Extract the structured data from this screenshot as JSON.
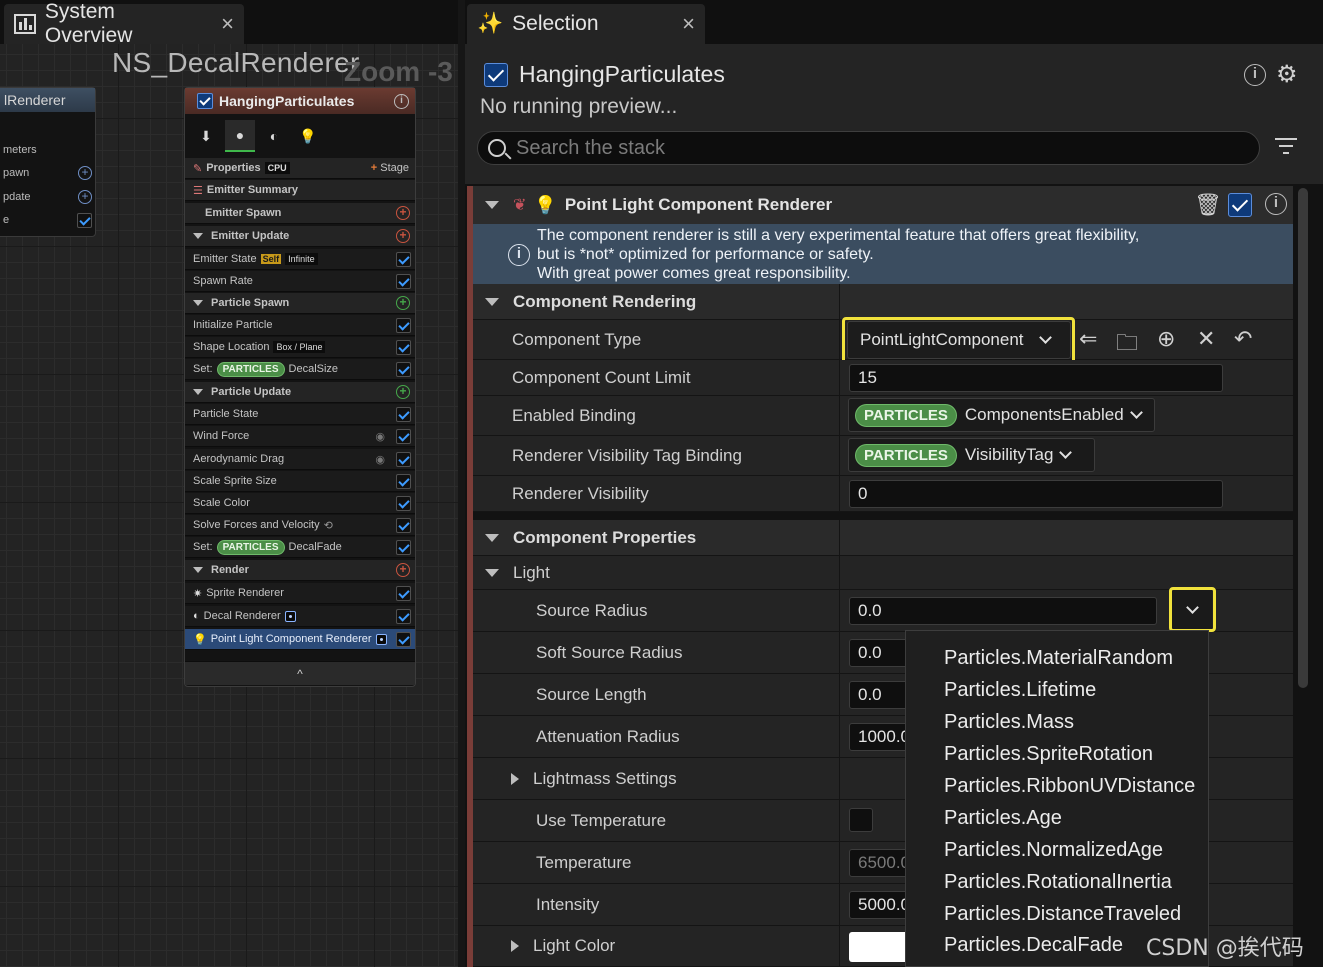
{
  "left_tab": {
    "title": "System Overview",
    "close": "×"
  },
  "graph": {
    "title": "NS_DecalRenderer",
    "zoom": "Zoom -3"
  },
  "node_left": {
    "title": "lRenderer",
    "rows": [
      "meters",
      "pawn",
      "pdate",
      "e"
    ]
  },
  "node_main": {
    "title": "HangingParticulates",
    "properties_label": "Properties",
    "cpu_badge": "CPU",
    "stage_label": "Stage",
    "rows": [
      {
        "label": "Emitter Summary"
      },
      {
        "label": "Emitter Spawn"
      },
      {
        "label": "Emitter Update"
      },
      {
        "label": "Emitter State",
        "badge1": "Self",
        "badge2": "Infinite"
      },
      {
        "label": "Spawn Rate"
      },
      {
        "label": "Particle Spawn"
      },
      {
        "label": "Initialize Particle"
      },
      {
        "label": "Shape Location",
        "badge2": "Box / Plane"
      },
      {
        "label": "Set:",
        "pill": "PARTICLES",
        "suffix": "DecalSize"
      },
      {
        "label": "Particle Update"
      },
      {
        "label": "Particle State"
      },
      {
        "label": "Wind Force"
      },
      {
        "label": "Aerodynamic Drag"
      },
      {
        "label": "Scale Sprite Size"
      },
      {
        "label": "Scale Color"
      },
      {
        "label": "Solve Forces and Velocity"
      },
      {
        "label": "Set:",
        "pill": "PARTICLES",
        "suffix": "DecalFade"
      },
      {
        "label": "Render"
      },
      {
        "label": "Sprite Renderer"
      },
      {
        "label": "Decal Renderer"
      },
      {
        "label": "Point Light Component Renderer"
      }
    ],
    "collapse": "^"
  },
  "right_tab": {
    "title": "Selection",
    "close": "×"
  },
  "selection": {
    "name": "HangingParticulates",
    "status": "No running preview...",
    "search_placeholder": "Search the stack"
  },
  "renderer": {
    "title": "Point Light Component Renderer",
    "warning": [
      "The component renderer is still a very experimental feature that offers great flexibility,",
      "but is *not* optimized for performance or safety.",
      "With great power comes great responsibility."
    ]
  },
  "properties": {
    "component_rendering": "Component Rendering",
    "component_type_label": "Component Type",
    "component_type_value": "PointLightComponent",
    "count_limit_label": "Component Count Limit",
    "count_limit_value": "15",
    "enabled_binding_label": "Enabled Binding",
    "enabled_binding_pill": "PARTICLES",
    "enabled_binding_value": "ComponentsEnabled",
    "vis_tag_label": "Renderer Visibility Tag Binding",
    "vis_tag_pill": "PARTICLES",
    "vis_tag_value": "VisibilityTag",
    "renderer_vis_label": "Renderer Visibility",
    "renderer_vis_value": "0",
    "component_properties": "Component Properties",
    "light": "Light",
    "source_radius_label": "Source Radius",
    "source_radius_value": "0.0",
    "soft_source_radius_label": "Soft Source Radius",
    "soft_source_radius_value": "0.0",
    "source_length_label": "Source Length",
    "source_length_value": "0.0",
    "attenuation_label": "Attenuation Radius",
    "attenuation_value": "1000.0",
    "lightmass_label": "Lightmass Settings",
    "use_temp_label": "Use Temperature",
    "temperature_label": "Temperature",
    "temperature_value": "6500.0",
    "intensity_label": "Intensity",
    "intensity_value": "5000.0",
    "light_color_label": "Light Color"
  },
  "dropdown": [
    "Particles.MaterialRandom",
    "Particles.Lifetime",
    "Particles.Mass",
    "Particles.SpriteRotation",
    "Particles.RibbonUVDistance",
    "Particles.Age",
    "Particles.NormalizedAge",
    "Particles.RotationalInertia",
    "Particles.DistanceTraveled",
    "Particles.DecalFade"
  ],
  "watermark": "CSDN @挨代码"
}
